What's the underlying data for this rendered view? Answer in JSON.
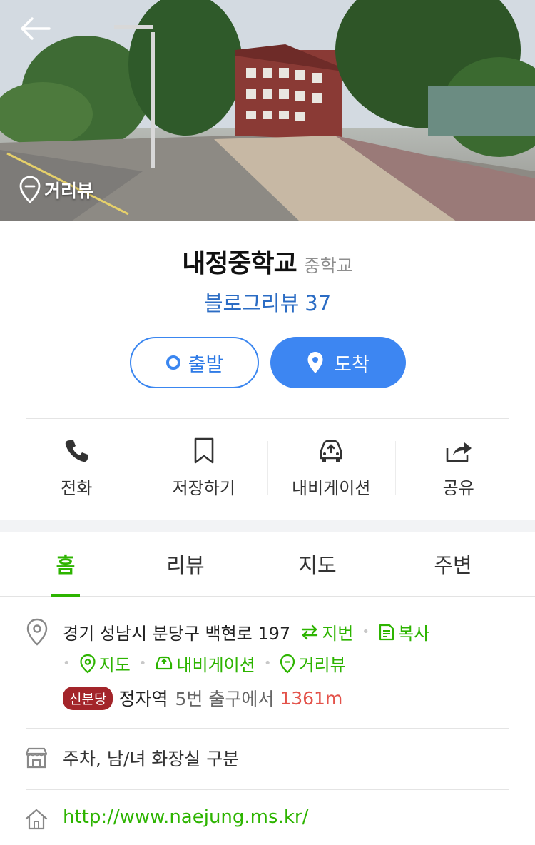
{
  "hero": {
    "back_icon": "arrow-left-icon",
    "roadview_label": "거리뷰",
    "roadview_icon": "map-pin-minus-icon"
  },
  "place": {
    "name": "내정중학교",
    "category": "중학교",
    "blog_review_label": "블로그리뷰",
    "blog_review_count": "37"
  },
  "route": {
    "depart_label": "출발",
    "arrive_label": "도착",
    "accent": "#3d86f2"
  },
  "actions": [
    {
      "label": "전화",
      "icon": "phone-icon"
    },
    {
      "label": "저장하기",
      "icon": "bookmark-icon"
    },
    {
      "label": "내비게이션",
      "icon": "car-navigation-icon"
    },
    {
      "label": "공유",
      "icon": "share-icon"
    }
  ],
  "tabs": [
    {
      "label": "홈",
      "active": true
    },
    {
      "label": "리뷰",
      "active": false
    },
    {
      "label": "지도",
      "active": false
    },
    {
      "label": "주변",
      "active": false
    }
  ],
  "address": {
    "text": "경기 성남시 분당구 백현로 197",
    "jibun_label": "지번",
    "copy_label": "복사",
    "map_label": "지도",
    "navi_label": "내비게이션",
    "roadview_label": "거리뷰"
  },
  "transit": {
    "line_badge": "신분당",
    "line_color": "#a3252a",
    "station": "정자역",
    "exit_text": "5번 출구에서",
    "distance": "1361m"
  },
  "facilities": {
    "text": "주차, 남/녀 화장실 구분"
  },
  "website": {
    "url": "http://www.naejung.ms.kr/"
  },
  "colors": {
    "green": "#2db400",
    "blue_link": "#2b6cc4",
    "distance_red": "#e3524a"
  }
}
